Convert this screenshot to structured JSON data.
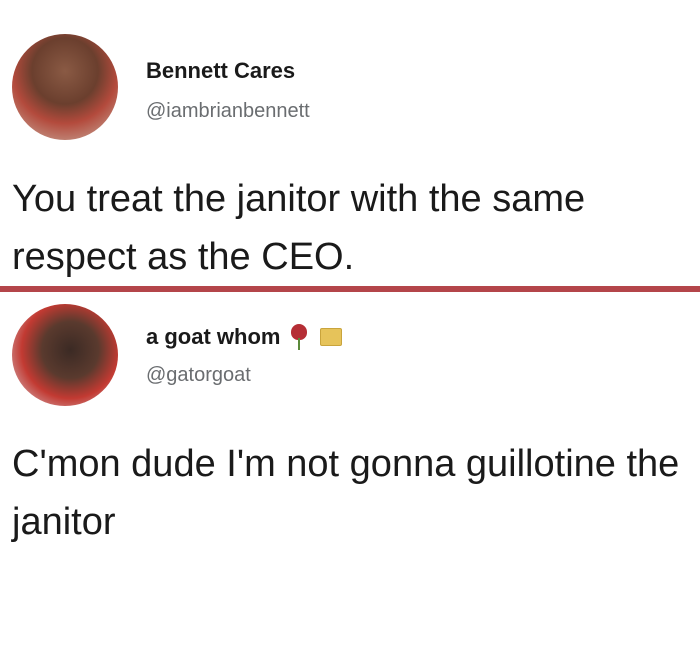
{
  "tweets": [
    {
      "display_name": "Bennett Cares",
      "handle": "@iambrianbennett",
      "text": "You treat the janitor with the same respect as the CEO."
    },
    {
      "display_name": "a goat whom",
      "handle": "@gatorgoat",
      "name_emojis": [
        "rose-icon",
        "envelope-icon"
      ],
      "text": "C'mon dude I'm not gonna guillotine the janitor"
    }
  ],
  "colors": {
    "divider": "#b4454a",
    "handle": "#6a6d70",
    "text": "#1a1a1a",
    "background": "#ffffff"
  }
}
